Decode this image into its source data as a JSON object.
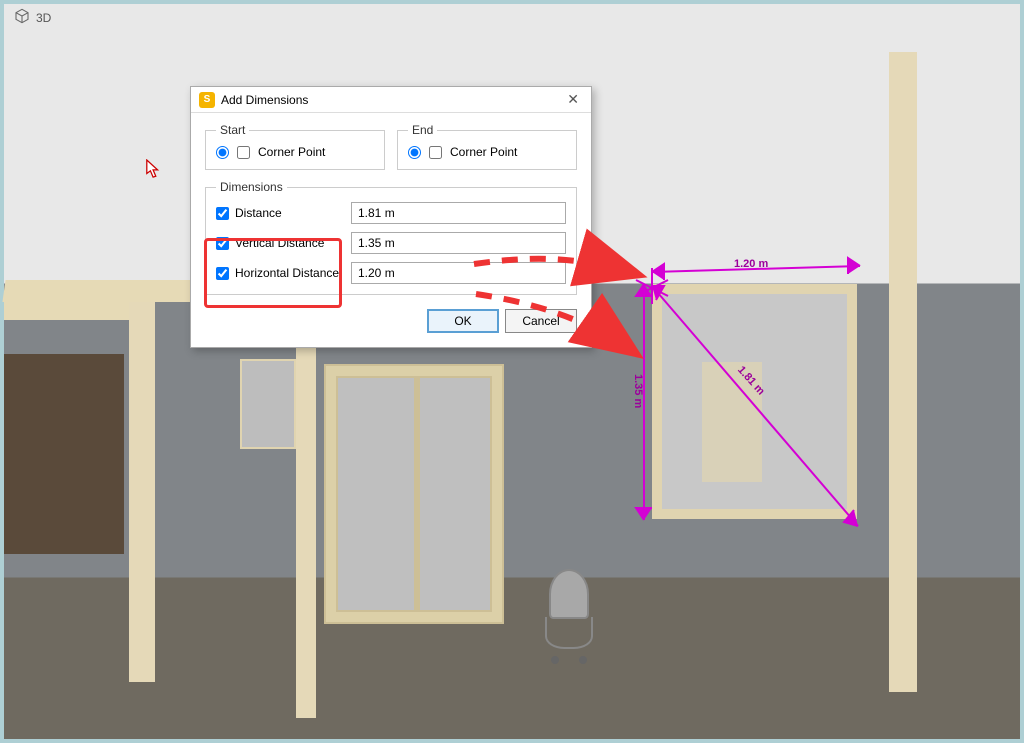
{
  "topbar": {
    "label": "3D"
  },
  "dialog": {
    "title": "Add Dimensions",
    "start": {
      "legend": "Start",
      "corner_label": "Corner Point"
    },
    "end": {
      "legend": "End",
      "corner_label": "Corner Point"
    },
    "dimensions": {
      "legend": "Dimensions",
      "distance_label": "Distance",
      "distance_value": "1.81 m",
      "vertical_label": "Vertical Distance",
      "vertical_value": "1.35 m",
      "horizontal_label": "Horizontal Distance",
      "horizontal_value": "1.20 m"
    },
    "ok": "OK",
    "cancel": "Cancel"
  },
  "scene_labels": {
    "top": "1.20 m",
    "left": "1.35 m",
    "diag": "1.81 m"
  },
  "colors": {
    "accent_magenta": "#d400d4",
    "annotation_red": "#e33333",
    "dialog_accent": "#5a9fd4"
  }
}
